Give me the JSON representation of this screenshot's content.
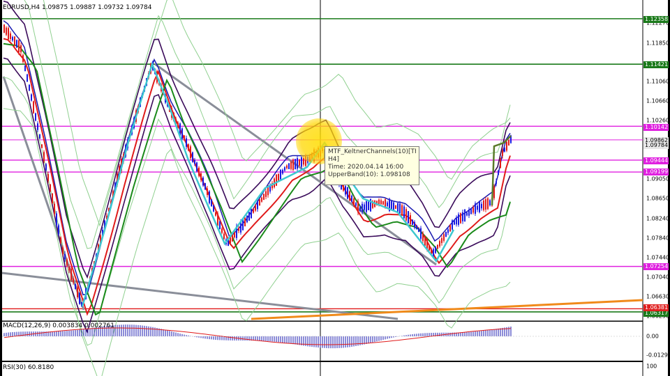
{
  "chart": {
    "symbol_header": "EURUSD,H4  1.09875 1.09887 1.09732 1.09784",
    "macd_header": "MACD(12,26,9) 0.003834 0.002761",
    "rsi_header": "RSI(30) 60.8180"
  },
  "price_axis": {
    "ticks": [
      "1.12270",
      "1.11850",
      "1.11430",
      "1.11060",
      "1.10660",
      "1.10260",
      "1.09050",
      "1.08650",
      "1.08240",
      "1.07840",
      "1.07440",
      "1.07040",
      "1.06630",
      "1.06230"
    ],
    "price_tags": [
      {
        "label": "1.12358",
        "color": "#1a7a1a"
      },
      {
        "label": "1.11421",
        "color": "#1a7a1a"
      },
      {
        "label": "1.10142",
        "color": "#e020e0"
      },
      {
        "label": "1.09862",
        "color": "#e8e8e8",
        "text": "#000"
      },
      {
        "label": "1.09784",
        "color": "#e8e8e8",
        "text": "#000"
      },
      {
        "label": "1.09444",
        "color": "#e020e0"
      },
      {
        "label": "1.09199",
        "color": "#e020e0"
      },
      {
        "label": "1.07254",
        "color": "#e020e0"
      },
      {
        "label": "1.06317",
        "color": "#1a7a1a"
      },
      {
        "label": "1.06381",
        "color": "#e02020"
      }
    ]
  },
  "macd_axis": {
    "ticks": [
      "0.00",
      "-0.012919"
    ]
  },
  "rsi_axis": {
    "ticks": [
      "100"
    ]
  },
  "tooltip": {
    "line1": "MTF_KeltnerChannels(10)[TF:",
    "line2": "H4]",
    "line3": "Time: 2020.04.14 16:00",
    "line4": "UpperBand(10): 1.098108"
  },
  "colors": {
    "bull": "#1a1ae0",
    "bear": "#e01a1a",
    "hline_green": "#1a7a1a",
    "hline_magenta": "#e020e0",
    "ma_red": "#e01a1a",
    "ma_green": "#1a8a1a",
    "ma_navy": "#1a1ab0",
    "ma_purple": "#3a0a5a",
    "bands_light": "#8fd08f",
    "trend_gray": "#8a8e99",
    "trend_orange": "#f08a1a",
    "zigzag": "#3ec8d0"
  }
}
